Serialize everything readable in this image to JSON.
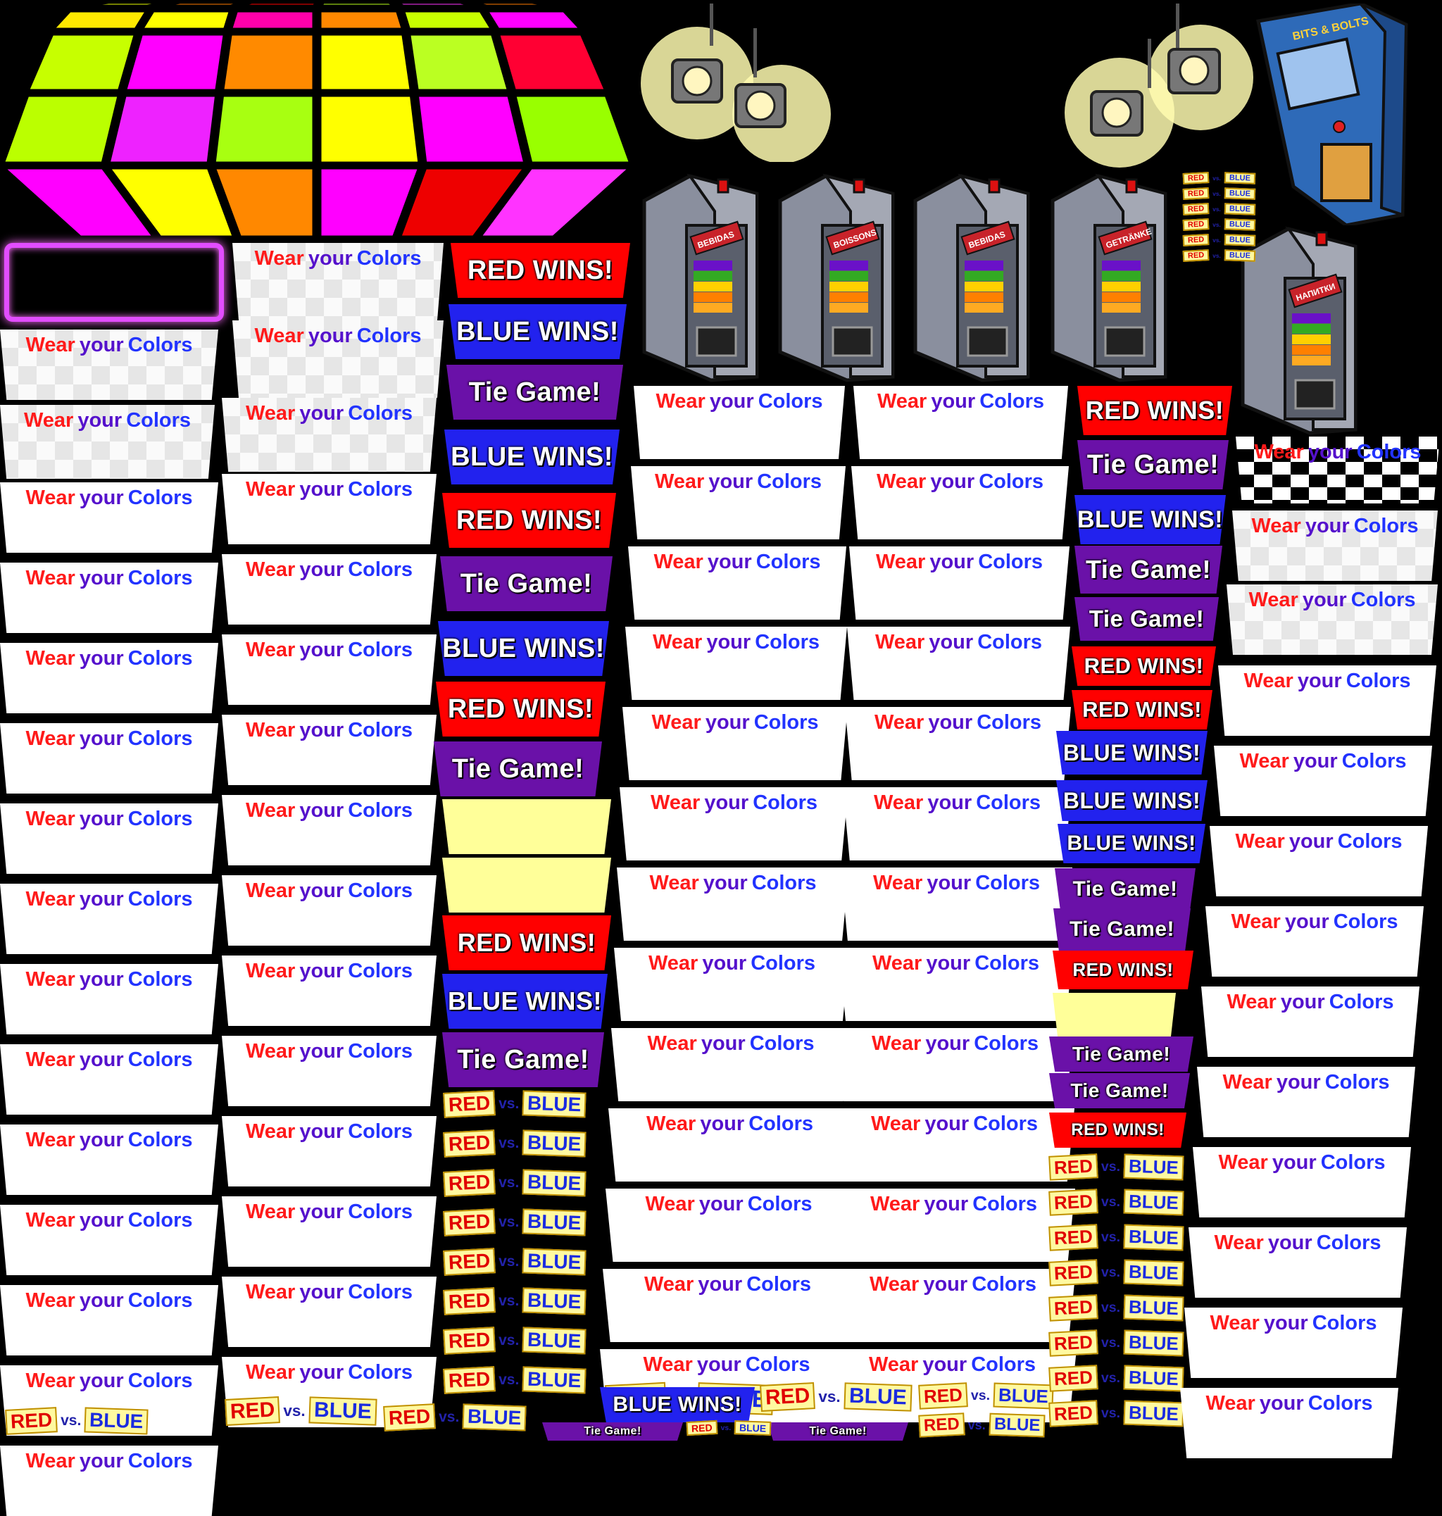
{
  "vending_labels": [
    "BEBIDAS",
    "BOISSONS",
    "BEBIDAS",
    "GETRÄNKE",
    "НАПИТКИ"
  ],
  "arcade_title": "BITS & BOLTS",
  "wear_colors": {
    "w": "Wear",
    "y": "your",
    "c": "Colors"
  },
  "banners": {
    "red": "RED WINS!",
    "blue": "BLUE WINS!",
    "tie": "Tie Game!"
  },
  "rvb": {
    "r": "RED",
    "v": "vs.",
    "b": "BLUE"
  },
  "colors": {
    "red": "#ff0000",
    "blue": "#2222ee",
    "purple": "#6a11a8",
    "floor_bg": "#000000"
  }
}
